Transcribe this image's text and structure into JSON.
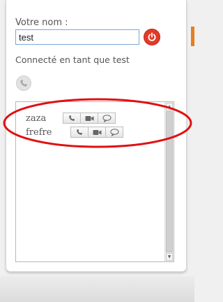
{
  "form": {
    "name_label": "Votre nom :",
    "name_value": "test"
  },
  "status": {
    "connected_text": "Connecté en tant que test"
  },
  "users": [
    {
      "name": "zaza"
    },
    {
      "name": "frefre"
    }
  ],
  "colors": {
    "accent_orange": "#e57e22",
    "power_red": "#e23b28",
    "annotation_red": "#e01010"
  },
  "icons": {
    "power": "power-icon",
    "phone": "phone-icon",
    "video": "video-camera-icon",
    "chat": "chat-bubble-icon"
  }
}
